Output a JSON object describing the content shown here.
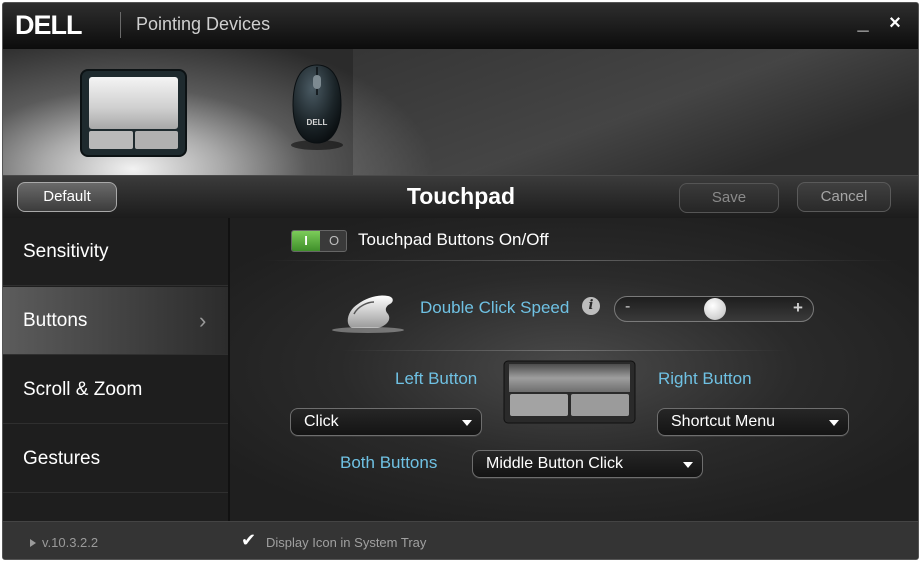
{
  "window": {
    "brand_logo_text": "DELL",
    "title": "Pointing Devices",
    "minimize_glyph": "_",
    "close_glyph": "×"
  },
  "banner": {
    "devices": [
      {
        "name": "touchpad",
        "selected": true
      },
      {
        "name": "mouse",
        "selected": false,
        "mouse_logo_text": "DELL"
      }
    ]
  },
  "toolbar": {
    "default_label": "Default",
    "heading": "Touchpad",
    "save_label": "Save",
    "cancel_label": "Cancel"
  },
  "sidebar": {
    "items": [
      {
        "label": "Sensitivity",
        "active": false
      },
      {
        "label": "Buttons",
        "active": true
      },
      {
        "label": "Scroll & Zoom",
        "active": false
      },
      {
        "label": "Gestures",
        "active": false
      }
    ],
    "chevron": "›"
  },
  "content": {
    "toggle": {
      "on_label": "I",
      "off_label": "O",
      "state": "on",
      "label": "Touchpad Buttons On/Off"
    },
    "double_click": {
      "label": "Double Click Speed",
      "info_glyph": "i",
      "minus": "-",
      "plus": "+",
      "value_fraction": 0.5
    },
    "left_button": {
      "label": "Left Button",
      "value": "Click"
    },
    "right_button": {
      "label": "Right Button",
      "value": "Shortcut Menu"
    },
    "both_buttons": {
      "label": "Both Buttons",
      "value": "Middle Button Click"
    }
  },
  "statusbar": {
    "version": "v.10.3.2.2",
    "tray_checked": true,
    "tray_check_glyph": "✔",
    "tray_label": "Display Icon in System Tray"
  },
  "colors": {
    "accent_blue": "#6fc1e3",
    "toggle_green": "#5aaa3a",
    "background": "#1b1b1b"
  }
}
